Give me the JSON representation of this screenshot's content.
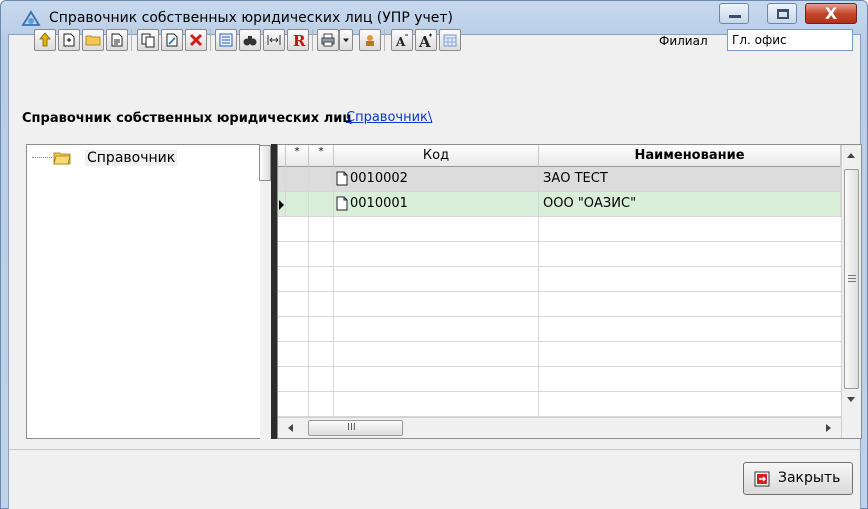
{
  "window": {
    "title": "Справочник собственных юридических лиц (УПР учет)",
    "close_symbol": "X"
  },
  "toolbar": {
    "buttons": [
      {
        "name": "refresh-up-icon"
      },
      {
        "name": "new-record-icon"
      },
      {
        "name": "new-folder-icon"
      },
      {
        "name": "edit-record-icon"
      },
      {
        "name": "copy-icon"
      },
      {
        "name": "edit-form-icon"
      },
      {
        "name": "delete-icon"
      },
      {
        "name": "list-view-icon"
      },
      {
        "name": "find-binoculars-icon"
      },
      {
        "name": "fit-width-icon"
      },
      {
        "name": "report-r-icon"
      },
      {
        "name": "print-icon"
      },
      {
        "name": "print-dropdown-icon"
      },
      {
        "name": "tools-icon"
      },
      {
        "name": "font-decrease-icon"
      },
      {
        "name": "font-increase-icon"
      },
      {
        "name": "calendar-icon"
      }
    ],
    "branch_label": "Филиал",
    "branch_value": "Гл. офис"
  },
  "header": {
    "title": "Справочник собственных юридических лиц",
    "breadcrumb_link": "Справочник\\"
  },
  "tree": {
    "root_label": "Справочник"
  },
  "grid": {
    "columns": [
      "*",
      "*",
      "Код",
      "Наименование"
    ],
    "rows": [
      {
        "code": "0010002",
        "name": "ЗАО ТЕСТ",
        "state": "selected"
      },
      {
        "code": "0010001",
        "name": "ООО \"ОАЗИС\"",
        "state": "current"
      }
    ],
    "scroll_thumb_marker": "III"
  },
  "footer": {
    "close_label": "Закрыть"
  }
}
